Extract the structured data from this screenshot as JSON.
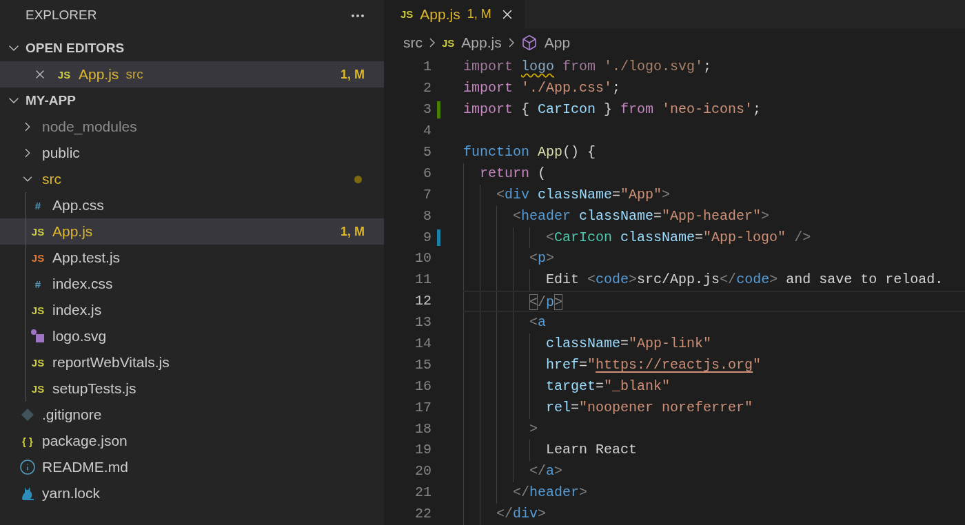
{
  "sidebar": {
    "title": "EXPLORER",
    "sections": [
      {
        "kind": "open-editors",
        "title": "OPEN EDITORS",
        "expanded": true,
        "items": [
          {
            "kind": "js",
            "icon_label": "JS",
            "name": "App.js",
            "folder": "src",
            "badge": "1, M",
            "modified": true,
            "selected": true
          }
        ]
      },
      {
        "kind": "folder-tree",
        "title": "MY-APP",
        "expanded": true,
        "items": [
          {
            "kind": "folder",
            "name": "node_modules",
            "expanded": false,
            "selected": false,
            "modified": false,
            "ignored": true
          },
          {
            "kind": "folder",
            "name": "public",
            "expanded": false,
            "selected": false,
            "modified": false,
            "ignored": false
          },
          {
            "kind": "folder",
            "name": "src",
            "expanded": true,
            "selected": false,
            "modified": true,
            "ignored": false,
            "children": [
              {
                "kind": "css",
                "icon_label": "#",
                "name": "App.css",
                "selected": false,
                "modified": false,
                "ignored": false
              },
              {
                "kind": "js",
                "icon_label": "JS",
                "name": "App.js",
                "badge": "1, M",
                "selected": true,
                "modified": true,
                "ignored": false
              },
              {
                "kind": "js-test",
                "icon_label": "JS",
                "name": "App.test.js",
                "selected": false,
                "modified": false,
                "ignored": false
              },
              {
                "kind": "css",
                "icon_label": "#",
                "name": "index.css",
                "selected": false,
                "modified": false,
                "ignored": false
              },
              {
                "kind": "js",
                "icon_label": "JS",
                "name": "index.js",
                "selected": false,
                "modified": false,
                "ignored": false
              },
              {
                "kind": "svg",
                "name": "logo.svg",
                "selected": false,
                "modified": false,
                "ignored": false
              },
              {
                "kind": "js",
                "icon_label": "JS",
                "name": "reportWebVitals.js",
                "selected": false,
                "modified": false,
                "ignored": false
              },
              {
                "kind": "js",
                "icon_label": "JS",
                "name": "setupTests.js",
                "selected": false,
                "modified": false,
                "ignored": false
              }
            ]
          },
          {
            "kind": "git",
            "name": ".gitignore",
            "selected": false,
            "modified": false,
            "ignored": false
          },
          {
            "kind": "json",
            "icon_label": "{ }",
            "name": "package.json",
            "selected": false,
            "modified": false,
            "ignored": false
          },
          {
            "kind": "info",
            "name": "README.md",
            "selected": false,
            "modified": false,
            "ignored": false
          },
          {
            "kind": "yarn",
            "name": "yarn.lock",
            "selected": false,
            "modified": false,
            "ignored": false
          }
        ]
      }
    ]
  },
  "editor": {
    "tabs": [
      {
        "icon_label": "JS",
        "title": "App.js",
        "badge": "1, M",
        "modified": true,
        "selected": true
      }
    ],
    "breadcrumbs": [
      {
        "kind": "folder",
        "label": "src"
      },
      {
        "kind": "file",
        "icon_label": "JS",
        "label": "App.js"
      },
      {
        "kind": "symbol",
        "label": "App"
      }
    ],
    "lines": [
      {
        "number": "1",
        "current": false,
        "tokens": [
          {
            "kind": "unused-keyword",
            "text": "import "
          },
          {
            "kind": "warning-var",
            "text": "logo"
          },
          {
            "kind": "unused-keyword",
            "text": " from "
          },
          {
            "kind": "unused-string",
            "text": "'./logo.svg'"
          },
          {
            "kind": "plain",
            "text": ";"
          }
        ]
      },
      {
        "number": "2",
        "current": false,
        "tokens": [
          {
            "kind": "keyword",
            "text": "import "
          },
          {
            "kind": "string",
            "text": "'./App.css'"
          },
          {
            "kind": "plain",
            "text": ";"
          }
        ]
      },
      {
        "number": "3",
        "current": false,
        "gutter_mark": {
          "kind": "added"
        },
        "tokens": [
          {
            "kind": "keyword",
            "text": "import "
          },
          {
            "kind": "plain",
            "text": "{ "
          },
          {
            "kind": "variable",
            "text": "CarIcon"
          },
          {
            "kind": "plain",
            "text": " } "
          },
          {
            "kind": "keyword",
            "text": "from "
          },
          {
            "kind": "string",
            "text": "'neo-icons'"
          },
          {
            "kind": "plain",
            "text": ";"
          }
        ]
      },
      {
        "number": "4",
        "current": false
      },
      {
        "number": "5",
        "current": false,
        "tokens": [
          {
            "kind": "storage",
            "text": "function "
          },
          {
            "kind": "function",
            "text": "App"
          },
          {
            "kind": "plain",
            "text": "() {"
          }
        ]
      },
      {
        "number": "6",
        "current": false,
        "tokens": [
          {
            "kind": "keyword",
            "text": "  return"
          },
          {
            "kind": "plain",
            "text": " ("
          }
        ]
      },
      {
        "number": "7",
        "current": false,
        "tokens": [
          {
            "kind": "punct",
            "text": "    <"
          },
          {
            "kind": "tag",
            "text": "div"
          },
          {
            "kind": "attr",
            "text": " className"
          },
          {
            "kind": "plain",
            "text": "="
          },
          {
            "kind": "string",
            "text": "\"App\""
          },
          {
            "kind": "punct",
            "text": ">"
          }
        ]
      },
      {
        "number": "8",
        "current": false,
        "tokens": [
          {
            "kind": "punct",
            "text": "      <"
          },
          {
            "kind": "tag",
            "text": "header"
          },
          {
            "kind": "attr",
            "text": " className"
          },
          {
            "kind": "plain",
            "text": "="
          },
          {
            "kind": "string",
            "text": "\"App-header\""
          },
          {
            "kind": "punct",
            "text": ">"
          }
        ]
      },
      {
        "number": "9",
        "current": false,
        "gutter_mark": {
          "kind": "modified"
        },
        "tokens": [
          {
            "kind": "punct",
            "text": "          <"
          },
          {
            "kind": "component",
            "text": "CarIcon"
          },
          {
            "kind": "attr",
            "text": " className"
          },
          {
            "kind": "plain",
            "text": "="
          },
          {
            "kind": "string",
            "text": "\"App-logo\""
          },
          {
            "kind": "punct",
            "text": " />"
          }
        ]
      },
      {
        "number": "10",
        "current": false,
        "tokens": [
          {
            "kind": "punct",
            "text": "        <"
          },
          {
            "kind": "tag",
            "text": "p"
          },
          {
            "kind": "punct",
            "text": ">"
          }
        ]
      },
      {
        "number": "11",
        "current": false,
        "tokens": [
          {
            "kind": "plain",
            "text": "          Edit "
          },
          {
            "kind": "punct",
            "text": "<"
          },
          {
            "kind": "tag",
            "text": "code"
          },
          {
            "kind": "punct",
            "text": ">"
          },
          {
            "kind": "plain",
            "text": "src/App.js"
          },
          {
            "kind": "punct",
            "text": "</"
          },
          {
            "kind": "tag",
            "text": "code"
          },
          {
            "kind": "punct",
            "text": ">"
          },
          {
            "kind": "plain",
            "text": " and save to reload."
          }
        ]
      },
      {
        "number": "12",
        "current": true,
        "tokens": [
          {
            "kind": "matched-bracket",
            "text": "        <"
          },
          {
            "kind": "punct",
            "text": "/"
          },
          {
            "kind": "tag",
            "text": "p"
          },
          {
            "kind": "matched-bracket",
            "text": ">"
          }
        ]
      },
      {
        "number": "13",
        "current": false,
        "tokens": [
          {
            "kind": "punct",
            "text": "        <"
          },
          {
            "kind": "tag",
            "text": "a"
          }
        ]
      },
      {
        "number": "14",
        "current": false,
        "tokens": [
          {
            "kind": "attr",
            "text": "          className"
          },
          {
            "kind": "plain",
            "text": "="
          },
          {
            "kind": "string",
            "text": "\"App-link\""
          }
        ]
      },
      {
        "number": "15",
        "current": false,
        "tokens": [
          {
            "kind": "attr",
            "text": "          href"
          },
          {
            "kind": "plain",
            "text": "="
          },
          {
            "kind": "string",
            "text": "\""
          },
          {
            "kind": "link",
            "text": "https://reactjs.org"
          },
          {
            "kind": "string",
            "text": "\""
          }
        ]
      },
      {
        "number": "16",
        "current": false,
        "tokens": [
          {
            "kind": "attr",
            "text": "          target"
          },
          {
            "kind": "plain",
            "text": "="
          },
          {
            "kind": "string",
            "text": "\"_blank\""
          }
        ]
      },
      {
        "number": "17",
        "current": false,
        "tokens": [
          {
            "kind": "attr",
            "text": "          rel"
          },
          {
            "kind": "plain",
            "text": "="
          },
          {
            "kind": "string",
            "text": "\"noopener noreferrer\""
          }
        ]
      },
      {
        "number": "18",
        "current": false,
        "tokens": [
          {
            "kind": "punct",
            "text": "        >"
          }
        ]
      },
      {
        "number": "19",
        "current": false,
        "tokens": [
          {
            "kind": "plain",
            "text": "          Learn React"
          }
        ]
      },
      {
        "number": "20",
        "current": false,
        "tokens": [
          {
            "kind": "punct",
            "text": "        </"
          },
          {
            "kind": "tag",
            "text": "a"
          },
          {
            "kind": "punct",
            "text": ">"
          }
        ]
      },
      {
        "number": "21",
        "current": false,
        "tokens": [
          {
            "kind": "punct",
            "text": "      </"
          },
          {
            "kind": "tag",
            "text": "header"
          },
          {
            "kind": "punct",
            "text": ">"
          }
        ]
      },
      {
        "number": "22",
        "current": false,
        "tokens": [
          {
            "kind": "punct",
            "text": "    </"
          },
          {
            "kind": "tag",
            "text": "div"
          },
          {
            "kind": "punct",
            "text": ">"
          }
        ]
      }
    ]
  }
}
